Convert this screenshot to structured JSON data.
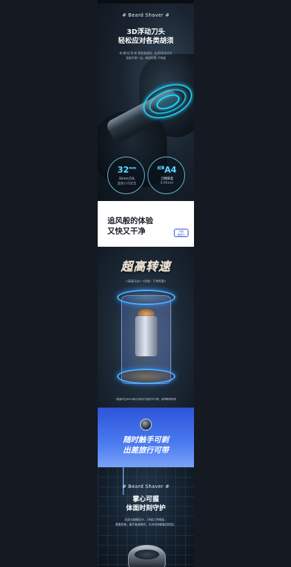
{
  "section1": {
    "tag": "# Beard Shaver #",
    "title_line1": "3D浮动刀头",
    "title_line2": "轻松应对各类胡须",
    "desc_line1": "软·硬·短·密·卷 等各类胡须，在3D浮动刀头",
    "desc_line2": "面前不堪一击，剃须利落 不残留",
    "badge_left": {
      "value": "32",
      "unit": "mm",
      "line1": "32mm刀头",
      "line2": "直径小巧灵活"
    },
    "badge_right": {
      "prefix": "超薄",
      "value": "A4",
      "line1": "刀网厚度",
      "line2": "0.05mm"
    }
  },
  "section2": {
    "line1": "追风般的体验",
    "line2": "又快又干净",
    "pill_line1": "大吸",
    "pill_line2": "剃须力"
  },
  "section3": {
    "title": "超高转速",
    "subtitle": "<高速马达> <刮胡 · 干净利落>",
    "footnote": "*高速马达8000转/分钟动力强劲不卡顿，用享畅快剃须"
  },
  "section4": {
    "line1": "随时触手可剃",
    "line2": "出差旅行可带"
  },
  "section5": {
    "tag": "# Beard Shaver #",
    "title_line1": "掌心可握",
    "title_line2": "体面时刻守护",
    "desc_line1": "机身无缝镶设计，18道工序精面，",
    "desc_line2": "厚重质感，握手能避移死，任何场地都能刮刮刮。"
  },
  "colors": {
    "accent_cyan": "#23d6ff",
    "brand_blue": "#2d54d9",
    "background": "#141922"
  }
}
